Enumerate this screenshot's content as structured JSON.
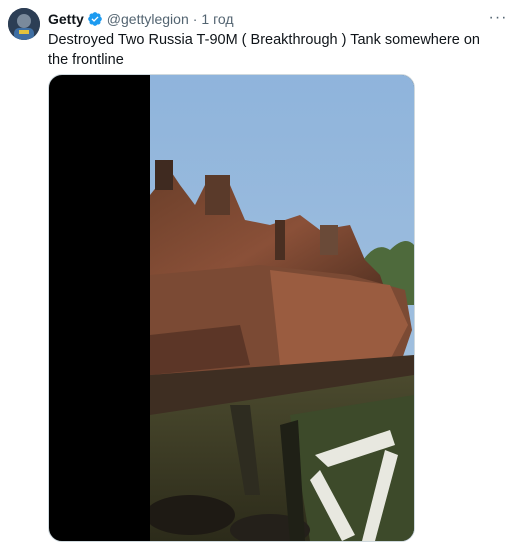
{
  "tweet": {
    "author_name": "Getty",
    "handle": "@gettylegion",
    "separator": "·",
    "time": "1 год",
    "text": "Destroyed Two Russia T-90M ( Breakthrough ) Tank somewhere on the frontline",
    "more_label": "···"
  },
  "media": {
    "type": "video"
  }
}
